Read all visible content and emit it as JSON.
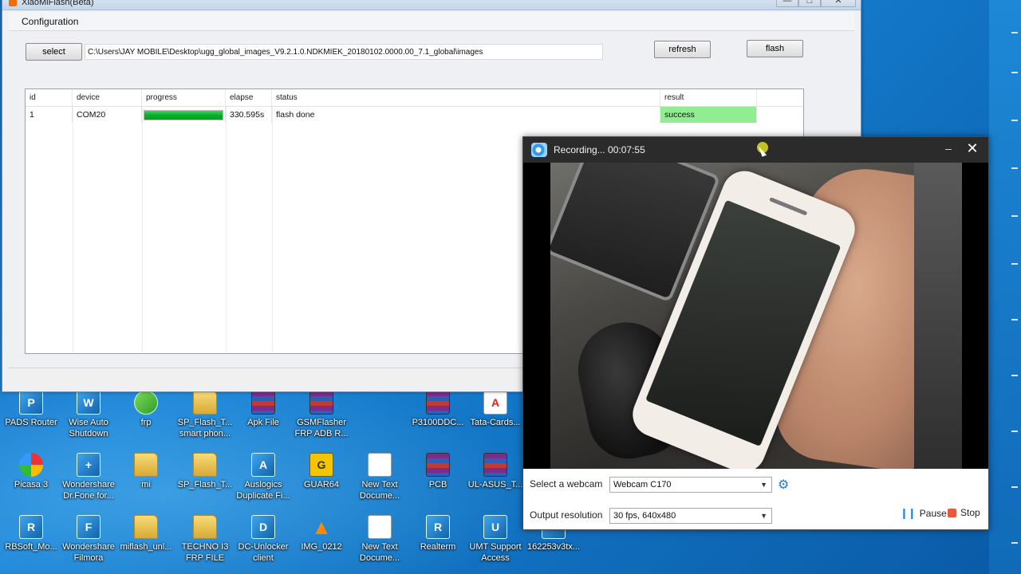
{
  "xiaomiflash": {
    "title": "XiaoMiFlash(Beta)",
    "menu": [
      "Configuration"
    ],
    "select_label": "select",
    "path_value": "C:\\Users\\JAY MOBILE\\Desktop\\ugg_global_images_V9.2.1.0.NDKMIEK_20180102.0000.00_7.1_global\\images",
    "refresh_label": "refresh",
    "flash_label": "flash",
    "columns": {
      "id": "id",
      "device": "device",
      "progress": "progress",
      "elapse": "elapse",
      "status": "status",
      "result": "result"
    },
    "rows": [
      {
        "id": "1",
        "device": "COM20",
        "progress": 1.0,
        "elapse": "330.595s",
        "status": "flash done",
        "result": "success"
      }
    ]
  },
  "recorder": {
    "title": "Recording... 00:07:55",
    "webcam_label": "Select a webcam",
    "webcam_value": "Webcam C170",
    "resolution_label": "Output resolution",
    "resolution_value": "30 fps, 640x480",
    "pause_label": "Pause",
    "stop_label": "Stop"
  },
  "desktop_icons": [
    {
      "label": "PADS Router",
      "kind": "app",
      "glyph": "P"
    },
    {
      "label": "Wise Auto Shutdown",
      "kind": "app",
      "glyph": "W"
    },
    {
      "label": "frp",
      "kind": "green",
      "glyph": ""
    },
    {
      "label": "SP_Flash_T... smart phon...",
      "kind": "folder",
      "glyph": ""
    },
    {
      "label": "Apk File",
      "kind": "rar",
      "glyph": ""
    },
    {
      "label": "GSMFlasher FRP ADB R...",
      "kind": "rar",
      "glyph": ""
    },
    {
      "label": "P3100DDC...",
      "kind": "rar",
      "glyph": ""
    },
    {
      "label": "Tata-Cards...",
      "kind": "pdf",
      "glyph": "A"
    },
    {
      "label": "Picasa 3",
      "kind": "picasa",
      "glyph": ""
    },
    {
      "label": "Wondershare Dr.Fone for...",
      "kind": "app",
      "glyph": "+"
    },
    {
      "label": "mi",
      "kind": "folder",
      "glyph": ""
    },
    {
      "label": "SP_Flash_T...",
      "kind": "folder",
      "glyph": ""
    },
    {
      "label": "Auslogics Duplicate Fi...",
      "kind": "app",
      "glyph": "A"
    },
    {
      "label": "GUAR64",
      "kind": "guar",
      "glyph": "G"
    },
    {
      "label": "New Text Docume...",
      "kind": "doc",
      "glyph": ""
    },
    {
      "label": "PCB",
      "kind": "rar",
      "glyph": ""
    },
    {
      "label": "UL-ASUS_T...",
      "kind": "rar",
      "glyph": ""
    },
    {
      "label": "RBSoft_Mo...",
      "kind": "app",
      "glyph": "R"
    },
    {
      "label": "Wondershare Filmora",
      "kind": "app",
      "glyph": "F"
    },
    {
      "label": "miflash_unl...",
      "kind": "folder",
      "glyph": ""
    },
    {
      "label": "TECHNO I3 FRP FILE",
      "kind": "folder",
      "glyph": ""
    },
    {
      "label": "DC-Unlocker client",
      "kind": "app",
      "glyph": "D"
    },
    {
      "label": "IMG_0212",
      "kind": "vlc",
      "glyph": "▲"
    },
    {
      "label": "New Text Docume...",
      "kind": "doc",
      "glyph": ""
    },
    {
      "label": "Realterm",
      "kind": "app",
      "glyph": "R"
    },
    {
      "label": "UMT Support Access",
      "kind": "app",
      "glyph": "U"
    },
    {
      "label": "162253v3tx...",
      "kind": "app",
      "glyph": ""
    }
  ],
  "colors": {
    "progress_fill": "#06b025",
    "result_success": "#90ee90",
    "accent_blue": "#1d7fd8",
    "stop_red": "#e8583a"
  }
}
